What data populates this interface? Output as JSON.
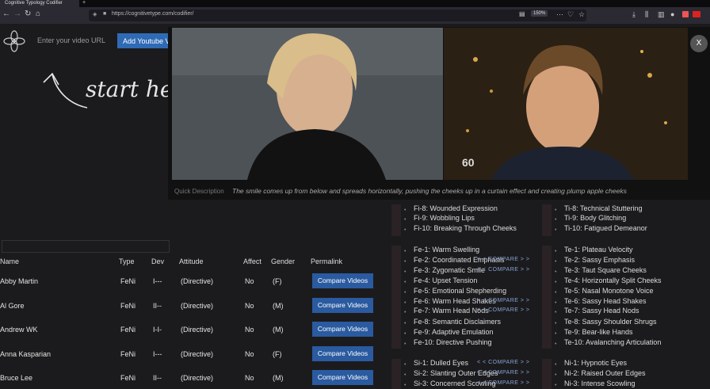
{
  "browser": {
    "tab_title": "Cognitive Typology Codifier",
    "url": "https://cognitivetype.com/codifier/",
    "zoom": "150%"
  },
  "page": {
    "url_placeholder": "Enter your video URL",
    "add_button": "Add Youtube V",
    "start_here": "start here"
  },
  "table": {
    "headers": [
      "Name",
      "Type",
      "Dev",
      "Attitude",
      "Affect",
      "Gender",
      "Permalink"
    ],
    "rows": [
      {
        "name": "Abby Martin",
        "type": "FeNi",
        "dev": "I---",
        "attitude": "(Directive)",
        "affect": "No",
        "gender": "(F)",
        "button": "Compare Videos"
      },
      {
        "name": "Al Gore",
        "type": "FeNi",
        "dev": "II--",
        "attitude": "(Directive)",
        "affect": "No",
        "gender": "(M)",
        "button": "Compare Videos"
      },
      {
        "name": "Andrew WK",
        "type": "FeNi",
        "dev": "I-I-",
        "attitude": "(Directive)",
        "affect": "No",
        "gender": "(M)",
        "button": "Compare Videos"
      },
      {
        "name": "Anna Kasparian",
        "type": "FeNi",
        "dev": "I---",
        "attitude": "(Directive)",
        "affect": "No",
        "gender": "(F)",
        "button": "Compare Videos"
      },
      {
        "name": "Bruce Lee",
        "type": "FeNi",
        "dev": "II--",
        "attitude": "(Directive)",
        "affect": "No",
        "gender": "(M)",
        "button": "Compare Videos"
      }
    ]
  },
  "overlay": {
    "close": "X",
    "quick_label": "Quick Description",
    "quick_text": "The smile comes up from below and spreads horizontally, pushing the cheeks up in a curtain effect and creating plump apple cheeks",
    "logo_text": "60"
  },
  "compare_label": "< < COMPARE > >",
  "left_col": [
    "Fi-8: Wounded Expression",
    "Fi-9: Wobbling Lips",
    "Fi-10: Breaking Through Cheeks",
    "Fe-1: Warm Swelling",
    "Fe-2: Coordinated Emphasis",
    "Fe-3: Zygomatic Smile",
    "Fe-4: Upset Tension",
    "Fe-5: Emotional Shepherding",
    "Fe-6: Warm Head Shakes",
    "Fe-7: Warm Head Nods",
    "Fe-8: Semantic Disclaimers",
    "Fe-9: Adaptive Emulation",
    "Fe-10: Directive Pushing",
    "Si-1: Dulled Eyes",
    "Si-2: Slanting Outer Edges",
    "Si-3: Concerned Scowling"
  ],
  "right_col": [
    "Ti-8: Technical Stuttering",
    "Ti-9: Body Glitching",
    "Ti-10: Fatigued Demeanor",
    "Te-1: Plateau Velocity",
    "Te-2: Sassy Emphasis",
    "Te-3: Taut Square Cheeks",
    "Te-4: Horizontally Split Cheeks",
    "Te-5: Nasal Monotone Voice",
    "Te-6: Sassy Head Shakes",
    "Te-7: Sassy Head Nods",
    "Te-8: Sassy Shoulder Shrugs",
    "Te-9: Bear-like Hands",
    "Te-10: Avalanching Articulation",
    "Ni-1: Hypnotic Eyes",
    "Ni-2: Raised Outer Edges",
    "Ni-3: Intense Scowling"
  ]
}
